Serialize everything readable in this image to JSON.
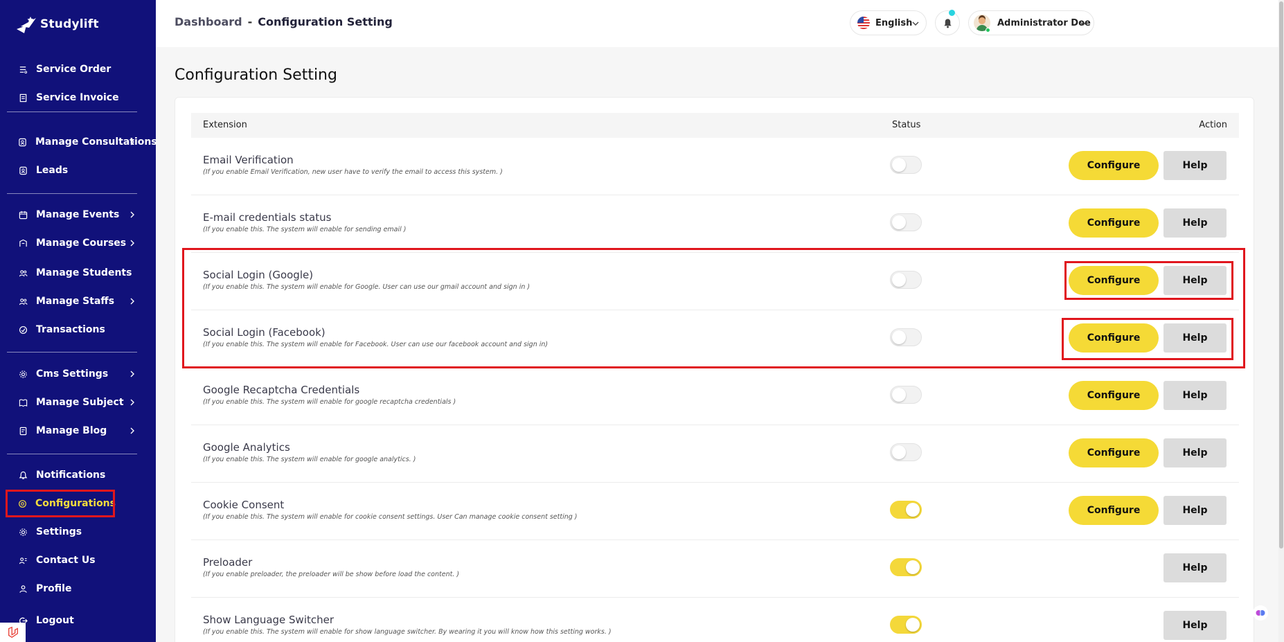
{
  "brand": {
    "name": "Studylift"
  },
  "sidebar": {
    "items": [
      {
        "label": "Service Order",
        "icon": "list-icon",
        "chevron": false
      },
      {
        "label": "Service Invoice",
        "icon": "invoice-icon",
        "chevron": false
      },
      {
        "label": "Manage Consultations",
        "icon": "consultation-icon",
        "chevron": true
      },
      {
        "label": "Leads",
        "icon": "leads-icon",
        "chevron": false
      },
      {
        "label": "Manage Events",
        "icon": "calendar-icon",
        "chevron": true
      },
      {
        "label": "Manage Courses",
        "icon": "courses-icon",
        "chevron": true
      },
      {
        "label": "Manage Students",
        "icon": "students-icon",
        "chevron": false
      },
      {
        "label": "Manage Staffs",
        "icon": "staffs-icon",
        "chevron": true
      },
      {
        "label": "Transactions",
        "icon": "transactions-icon",
        "chevron": false
      },
      {
        "label": "Cms Settings",
        "icon": "cms-gear-icon",
        "chevron": true
      },
      {
        "label": "Manage Subject",
        "icon": "book-icon",
        "chevron": true
      },
      {
        "label": "Manage Blog",
        "icon": "blog-icon",
        "chevron": true
      },
      {
        "label": "Notifications",
        "icon": "bell-icon",
        "chevron": false
      },
      {
        "label": "Configurations",
        "icon": "config-icon",
        "chevron": false,
        "active": true
      },
      {
        "label": "Settings",
        "icon": "settings-gear-icon",
        "chevron": false
      },
      {
        "label": "Contact Us",
        "icon": "contact-icon",
        "chevron": false
      },
      {
        "label": "Profile",
        "icon": "user-icon",
        "chevron": false
      },
      {
        "label": "Logout",
        "icon": "logout-icon",
        "chevron": false
      }
    ]
  },
  "header": {
    "breadcrumb_root": "Dashboard",
    "breadcrumb_sep": "-",
    "breadcrumb_current": "Configuration Setting",
    "language": "English",
    "user_name": "Administrator Doe"
  },
  "page": {
    "title": "Configuration Setting",
    "columns": {
      "extension": "Extension",
      "status": "Status",
      "action": "Action"
    },
    "configure_label": "Configure",
    "help_label": "Help",
    "rows": [
      {
        "title": "Email Verification",
        "desc": "(If you enable Email Verification, new user have to verify the email to access this system. )",
        "enabled": false,
        "configurable": true
      },
      {
        "title": "E-mail credentials status",
        "desc": "(If you enable this. The system will enable for sending email )",
        "enabled": false,
        "configurable": true
      },
      {
        "title": "Social Login (Google)",
        "desc": "(If you enable this. The system will enable for Google. User can use our gmail account and sign in )",
        "enabled": false,
        "configurable": true
      },
      {
        "title": "Social Login (Facebook)",
        "desc": "(If you enable this. The system will enable for Facebook. User can use our facebook account and sign in)",
        "enabled": false,
        "configurable": true
      },
      {
        "title": "Google Recaptcha Credentials",
        "desc": "(If you enable this. The system will enable for google recaptcha credentials )",
        "enabled": false,
        "configurable": true
      },
      {
        "title": "Google Analytics",
        "desc": "(If you enable this. The system will enable for google analytics. )",
        "enabled": false,
        "configurable": true
      },
      {
        "title": "Cookie Consent",
        "desc": "(If you enable this. The system will enable for cookie consent settings. User Can manage cookie consent setting )",
        "enabled": true,
        "configurable": true
      },
      {
        "title": "Preloader",
        "desc": "(If you enable preloader, the preloader will be show before load the content. )",
        "enabled": true,
        "configurable": false
      },
      {
        "title": "Show Language Switcher",
        "desc": "(If you enable this. The system will enable for show language switcher. By wearing it you will know how this setting works. )",
        "enabled": true,
        "configurable": false
      }
    ]
  },
  "colors": {
    "sidebar_bg": "#11117a",
    "accent_yellow": "#f5da36",
    "highlight_red": "#e0161d"
  }
}
